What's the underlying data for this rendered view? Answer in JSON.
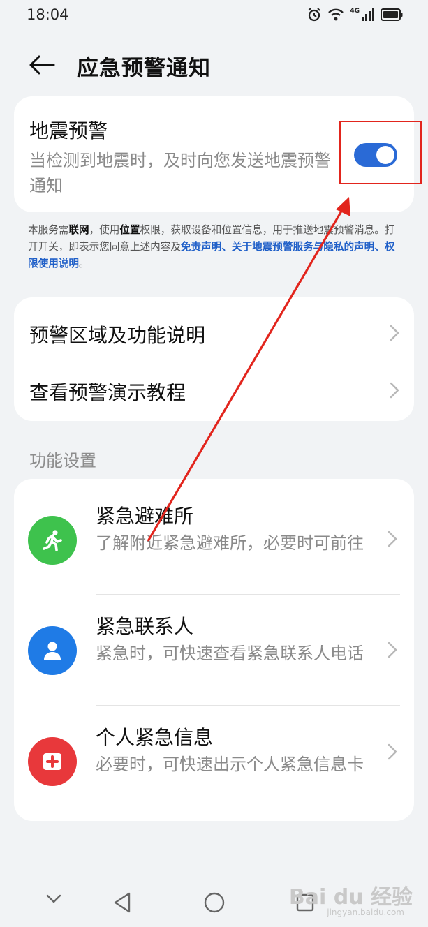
{
  "status_bar": {
    "time": "18:04",
    "network_label": "4G"
  },
  "header": {
    "title": "应急预警通知"
  },
  "earthquake": {
    "title": "地震预警",
    "description": "当检测到地震时，及时向您发送地震预警通知",
    "toggle_on": true
  },
  "notice": {
    "part1": "本服务需",
    "bold1": "联网",
    "part2": "，使用",
    "bold2": "位置",
    "part3": "权限，获取设备和位置信息，用于推送地震预警消息。打开开关，即表示您同意上述内容及",
    "link1": "免责声明",
    "sep1": "、",
    "link2": "关于地震预警服务与隐私的声明",
    "sep2": "、",
    "link3": "权限使用说明",
    "end": "。"
  },
  "info_rows": [
    {
      "label": "预警区域及功能说明"
    },
    {
      "label": "查看预警演示教程"
    }
  ],
  "section": {
    "label": "功能设置"
  },
  "functions": [
    {
      "title": "紧急避难所",
      "description": "了解附近紧急避难所，必要时可前往",
      "icon": "running-person-icon",
      "color": "#3ec24d"
    },
    {
      "title": "紧急联系人",
      "description": "紧急时，可快速查看紧急联系人电话",
      "icon": "person-icon",
      "color": "#1f7be6"
    },
    {
      "title": "个人紧急信息",
      "description": "必要时，可快速出示个人紧急信息卡",
      "icon": "medical-cross-icon",
      "color": "#e8383b"
    }
  ],
  "watermark": {
    "text": "Bai du 经验",
    "sub": "jingyan.baidu.com"
  },
  "colors": {
    "accent": "#2a6ad6",
    "annotation": "#e2251d",
    "link": "#1f5fc8"
  }
}
